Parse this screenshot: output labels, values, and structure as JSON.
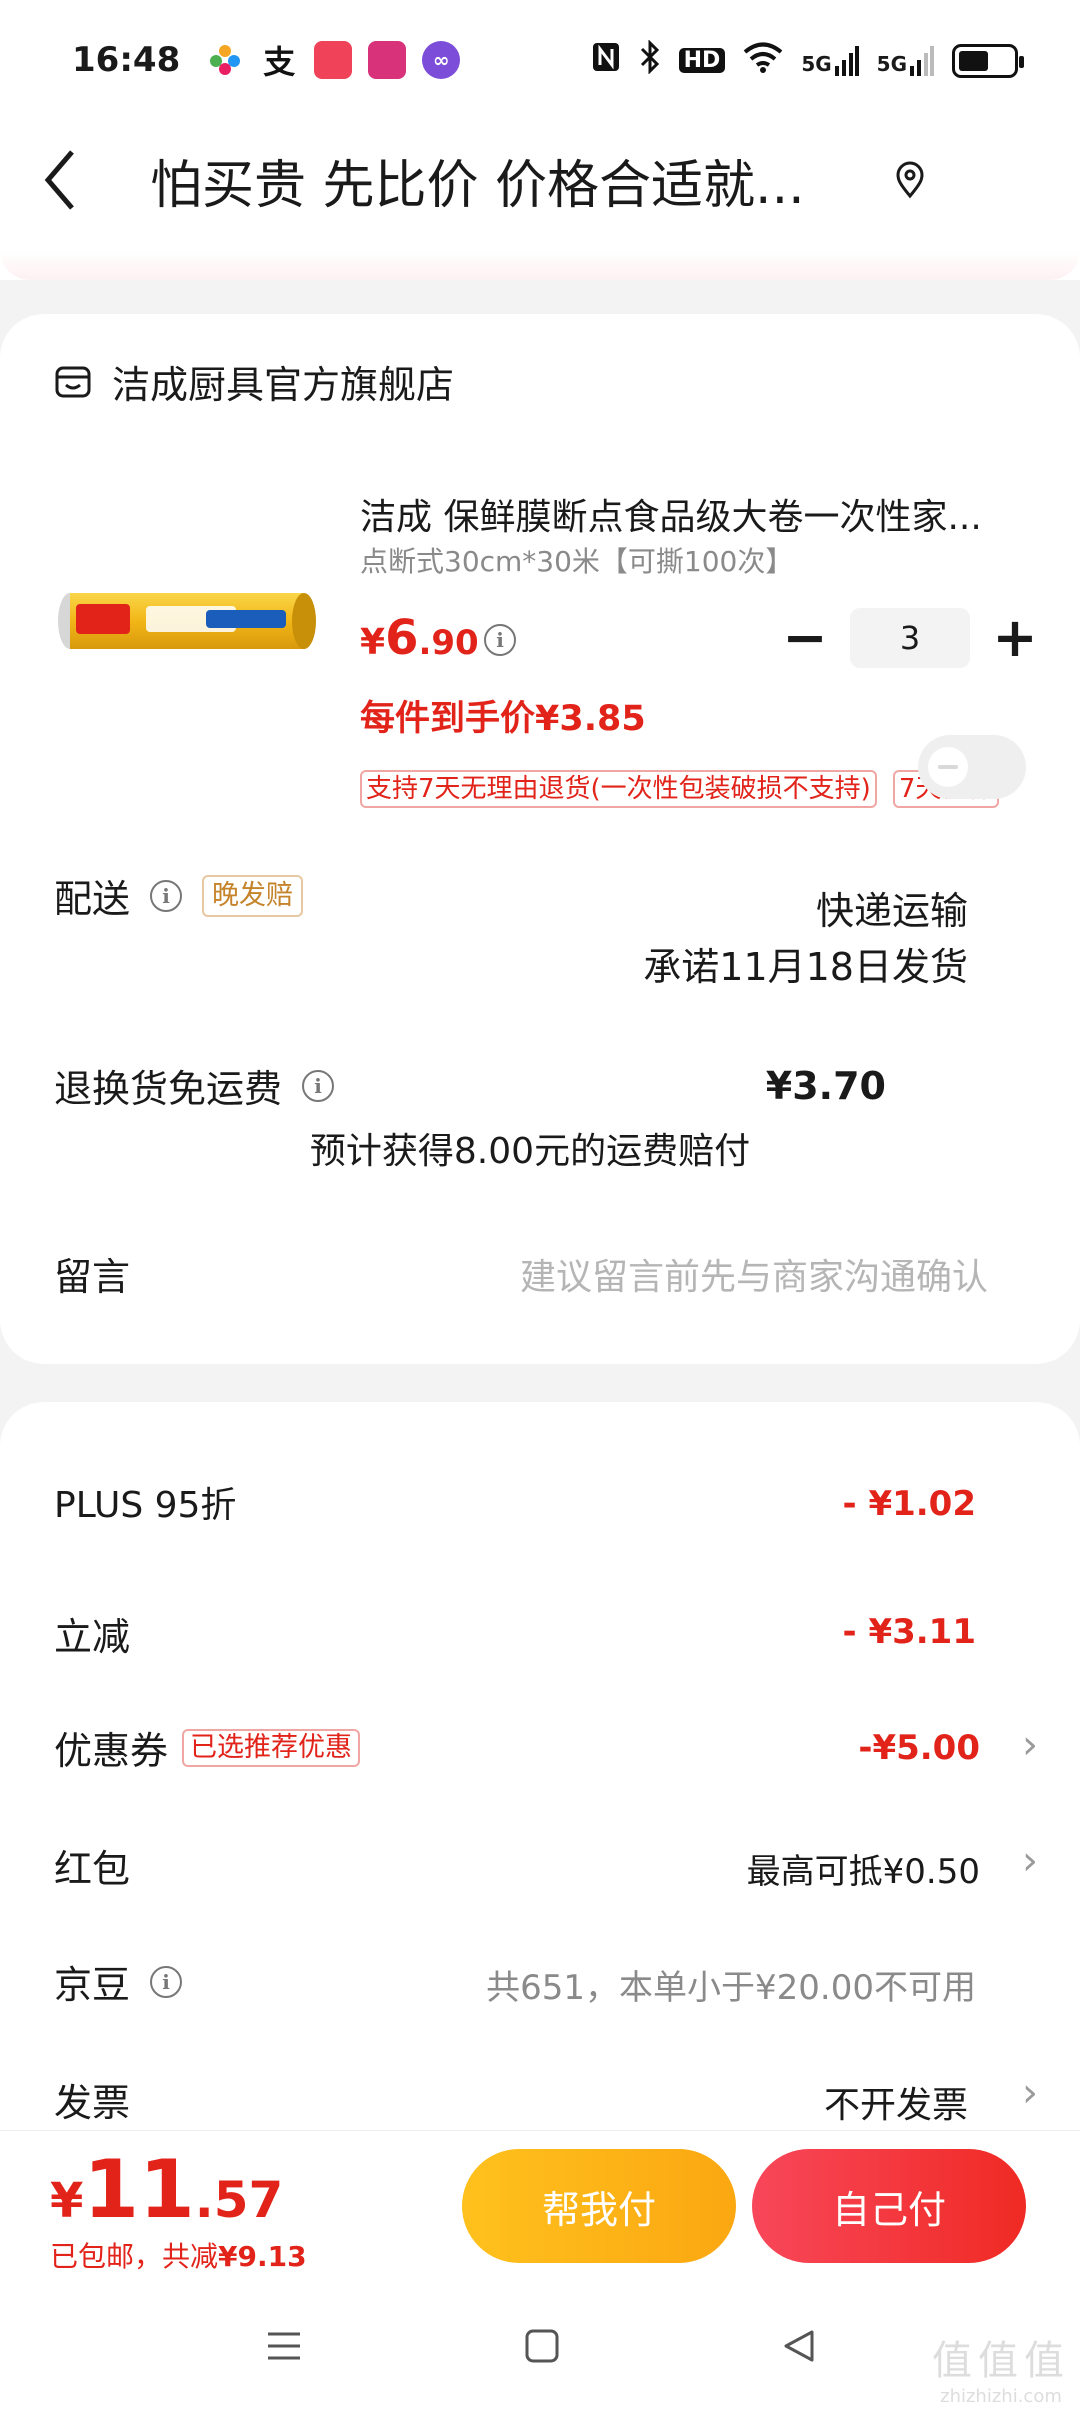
{
  "status_bar": {
    "time": "16:48",
    "network_labels": [
      "HD",
      "5G",
      "5G"
    ],
    "battery_level": 0.55
  },
  "header": {
    "title": "怕买贵 先比价 价格合适就..."
  },
  "store": {
    "name": "洁成厨具官方旗舰店"
  },
  "product": {
    "title": "洁成 保鲜膜断点食品级大卷一次性家...",
    "spec": "点断式30cm*30米【可撕100次】",
    "price_yen": "¥",
    "price_int": "6",
    "price_dec": ".90",
    "quantity": "3",
    "minus_label": "−",
    "plus_label": "+",
    "unit_price": "每件到手价¥3.85",
    "tags": [
      "支持7天无理由退货(一次性包装破损不支持)",
      "7天价保"
    ]
  },
  "delivery": {
    "label": "配送",
    "badge": "晚发赔",
    "method": "快递运输",
    "promise": "承诺11月18日发货"
  },
  "return_shipping": {
    "label": "退换货免运费",
    "price": "¥3.70",
    "note": "预计获得8.00元的运费赔付"
  },
  "message": {
    "label": "留言",
    "placeholder": "建议留言前先与商家沟通确认"
  },
  "discounts": {
    "plus": {
      "label": "PLUS 95折",
      "value": "- ¥1.02"
    },
    "instant": {
      "label": "立减",
      "value": "- ¥3.11"
    },
    "coupon": {
      "label": "优惠券",
      "badge": "已选推荐优惠",
      "value": "-¥5.00"
    },
    "redpacket": {
      "label": "红包",
      "value": "最高可抵¥0.50"
    },
    "jingdou": {
      "label": "京豆",
      "value": "共651，本单小于¥20.00不可用"
    },
    "invoice": {
      "label": "发票",
      "value": "不开发票"
    }
  },
  "bottom": {
    "total_yen": "¥",
    "total_int": "11",
    "total_dec": ".57",
    "sub_prefix": "已包邮，共减",
    "sub_amount": "¥9.13",
    "help_pay": "帮我付",
    "self_pay": "自己付"
  },
  "watermark": {
    "main": "值值值",
    "sub": "zhizhizhi.com"
  },
  "colors": {
    "accent_red": "#e2231a",
    "help_button": "#fdb514",
    "self_button": "#f33b3b"
  }
}
